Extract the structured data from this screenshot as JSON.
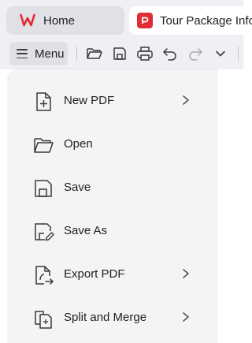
{
  "tabs": [
    {
      "label": "Home"
    },
    {
      "label": "Tour Package Info"
    }
  ],
  "toolbar": {
    "menu_label": "Menu",
    "icons": [
      "open-folder-icon",
      "save-icon",
      "print-icon",
      "undo-icon",
      "redo-icon",
      "chevron-down-icon"
    ]
  },
  "menu": {
    "items": [
      {
        "label": "New PDF",
        "icon": "new-pdf-icon",
        "has_submenu": true
      },
      {
        "label": "Open",
        "icon": "open-folder-icon",
        "has_submenu": false
      },
      {
        "label": "Save",
        "icon": "save-icon",
        "has_submenu": false
      },
      {
        "label": "Save As",
        "icon": "save-as-icon",
        "has_submenu": false
      },
      {
        "label": "Export PDF",
        "icon": "export-pdf-icon",
        "has_submenu": true
      },
      {
        "label": "Split and Merge",
        "icon": "split-merge-icon",
        "has_submenu": true
      }
    ]
  },
  "colors": {
    "brand_red": "#e02d37",
    "top_bar_bg": "#eef0f3",
    "menu_bg": "#f3f4f6"
  }
}
